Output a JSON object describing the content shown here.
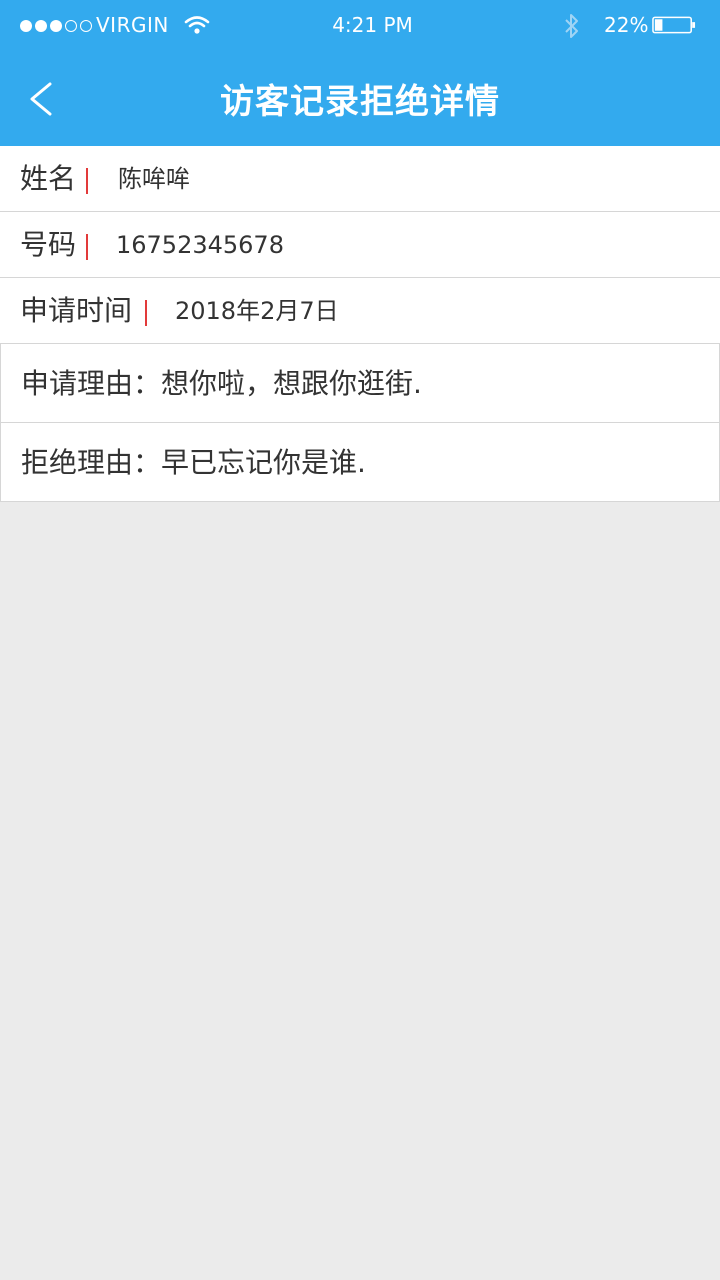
{
  "status_bar": {
    "signal": [
      "full",
      "full",
      "full",
      "empty",
      "empty"
    ],
    "carrier": "VIRGIN",
    "time": "4:21 PM",
    "battery_pct": "22%",
    "battery_level": 0.22
  },
  "nav": {
    "title": "访客记录拒绝详情"
  },
  "fields": [
    {
      "label": "姓名",
      "value": "陈哞哞"
    },
    {
      "label": "号码",
      "value": "16752345678"
    },
    {
      "label": "申请时间",
      "value": "2018年2月7日"
    }
  ],
  "reasons": [
    {
      "label": "申请理由",
      "sep": "：",
      "value": "想你啦，想跟你逛街."
    },
    {
      "label": "拒绝理由",
      "sep": "：",
      "value": "早已忘记你是谁."
    }
  ],
  "colors": {
    "header": "#33aaee",
    "accent_bar": "#e23a3a",
    "background": "#ebebeb"
  }
}
